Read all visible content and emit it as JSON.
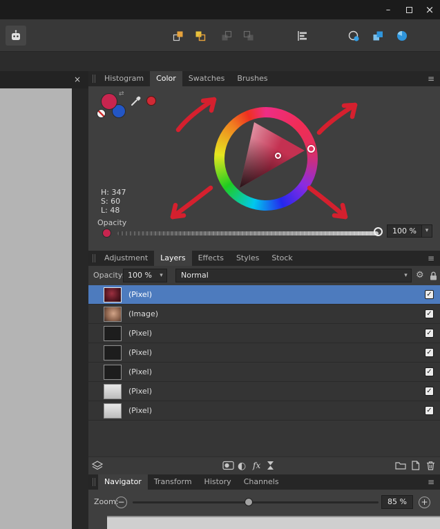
{
  "icons": {
    "minimize": "–",
    "close": "×",
    "menu": "≡",
    "dropdown": "▾",
    "check": "✓",
    "gear": "⚙",
    "half_circle": "◐",
    "fx": "fx",
    "swap": "⇄",
    "minus": "−",
    "plus": "+"
  },
  "color_panel": {
    "tabs": [
      {
        "label": "Histogram",
        "active": false
      },
      {
        "label": "Color",
        "active": true
      },
      {
        "label": "Swatches",
        "active": false
      },
      {
        "label": "Brushes",
        "active": false
      }
    ],
    "hsl": {
      "h": "H: 347",
      "s": "S: 60",
      "l": "L: 48"
    },
    "opacity_label": "Opacity",
    "opacity_value": "100 %",
    "selected_color_hex": "#c43151"
  },
  "layers_panel": {
    "tabs": [
      {
        "label": "Adjustment",
        "active": false
      },
      {
        "label": "Layers",
        "active": true
      },
      {
        "label": "Effects",
        "active": false
      },
      {
        "label": "Styles",
        "active": false
      },
      {
        "label": "Stock",
        "active": false
      }
    ],
    "opacity_label": "Opacity:",
    "opacity_value": "100 %",
    "blend_mode": "Normal",
    "layers": [
      {
        "label": "(Pixel)",
        "selected": true,
        "visible": true
      },
      {
        "label": "(Image)",
        "selected": false,
        "visible": true
      },
      {
        "label": "(Pixel)",
        "selected": false,
        "visible": true
      },
      {
        "label": "(Pixel)",
        "selected": false,
        "visible": true
      },
      {
        "label": "(Pixel)",
        "selected": false,
        "visible": true
      },
      {
        "label": "(Pixel)",
        "selected": false,
        "visible": true
      },
      {
        "label": "(Pixel)",
        "selected": false,
        "visible": true
      }
    ]
  },
  "navigator_panel": {
    "tabs": [
      {
        "label": "Navigator",
        "active": true
      },
      {
        "label": "Transform",
        "active": false
      },
      {
        "label": "History",
        "active": false
      },
      {
        "label": "Channels",
        "active": false
      }
    ],
    "zoom_label": "Zoom:",
    "zoom_value": "85 %"
  }
}
